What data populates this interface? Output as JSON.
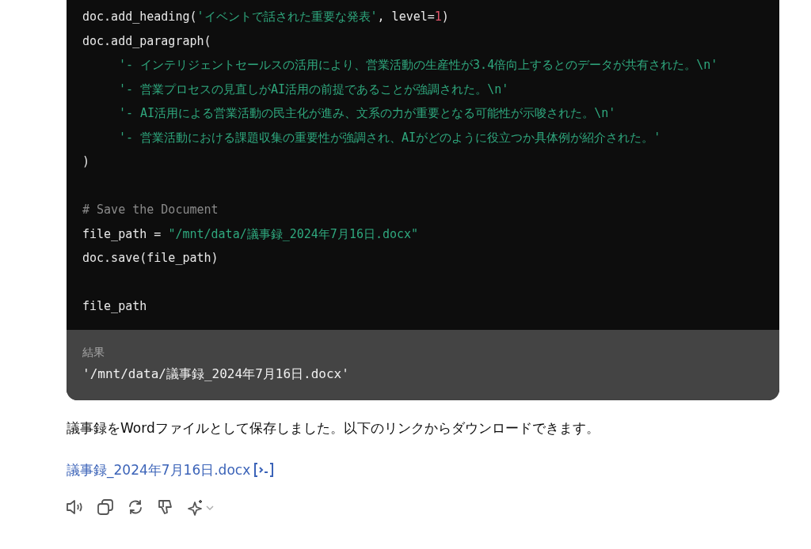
{
  "code_block": {
    "lines": [
      {
        "segments": [
          {
            "kind": "plain",
            "text": "doc.add_heading("
          },
          {
            "kind": "string",
            "text": "'イベントで話された重要な発表'"
          },
          {
            "kind": "plain",
            "text": ", level="
          },
          {
            "kind": "number",
            "text": "1"
          },
          {
            "kind": "plain",
            "text": ")"
          }
        ]
      },
      {
        "segments": [
          {
            "kind": "plain",
            "text": "doc.add_paragraph("
          }
        ]
      },
      {
        "indent": true,
        "segments": [
          {
            "kind": "string",
            "text": "'- インテリジェントセールスの活用により、営業活動の生産性が3.4倍向上するとのデータが共有された。\\n'"
          }
        ]
      },
      {
        "indent": true,
        "segments": [
          {
            "kind": "string",
            "text": "'- 営業プロセスの見直しがAI活用の前提であることが強調された。\\n'"
          }
        ]
      },
      {
        "indent": true,
        "segments": [
          {
            "kind": "string",
            "text": "'- AI活用による営業活動の民主化が進み、文系の力が重要となる可能性が示唆された。\\n'"
          }
        ]
      },
      {
        "indent": true,
        "segments": [
          {
            "kind": "string",
            "text": "'- 営業活動における課題収集の重要性が強調され、AIがどのように役立つか具体例が紹介された。'"
          }
        ]
      },
      {
        "segments": [
          {
            "kind": "plain",
            "text": ")"
          }
        ]
      },
      {
        "gap_before": true,
        "segments": [
          {
            "kind": "comment",
            "text": "# Save the Document"
          }
        ]
      },
      {
        "segments": [
          {
            "kind": "plain",
            "text": "file_path = "
          },
          {
            "kind": "string",
            "text": "\"/mnt/data/議事録_2024年7月16日.docx\""
          }
        ]
      },
      {
        "segments": [
          {
            "kind": "plain",
            "text": "doc.save(file_path)"
          }
        ]
      },
      {
        "gap_before": true,
        "segments": [
          {
            "kind": "plain",
            "text": "file_path"
          }
        ]
      }
    ]
  },
  "result": {
    "label": "結果",
    "value": "'/mnt/data/議事録_2024年7月16日.docx'"
  },
  "message": "議事録をWordファイルとして保存しました。以下のリンクからダウンロードできます。",
  "download_link": "議事録_2024年7月16日.docx",
  "actions": [
    {
      "kind": "speaker"
    },
    {
      "kind": "copy"
    },
    {
      "kind": "regenerate"
    },
    {
      "kind": "dislike"
    },
    {
      "kind": "model"
    }
  ]
}
